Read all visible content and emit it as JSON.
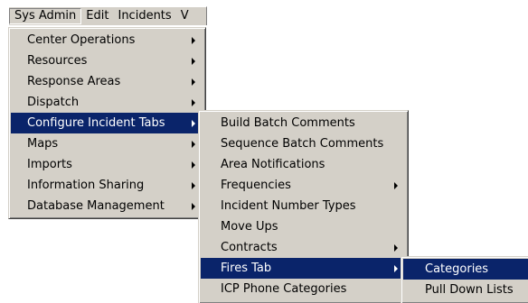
{
  "menubar": {
    "items": [
      "Sys Admin",
      "Edit",
      "Incidents",
      "V"
    ]
  },
  "sys_admin_menu": {
    "items": [
      "Center Operations",
      "Resources",
      "Response Areas",
      "Dispatch",
      "Configure Incident Tabs",
      "Maps",
      "Imports",
      "Information Sharing",
      "Database Management"
    ],
    "selected": "Configure Incident Tabs"
  },
  "configure_incident_tabs_menu": {
    "items": [
      "Build Batch Comments",
      "Sequence Batch Comments",
      "Area Notifications",
      "Frequencies",
      "Incident Number Types",
      "Move Ups",
      "Contracts",
      "Fires Tab",
      "ICP Phone Categories"
    ],
    "selected": "Fires Tab"
  },
  "fires_tab_menu": {
    "items": [
      "Categories",
      "Pull Down Lists"
    ],
    "selected": "Categories"
  },
  "colors": {
    "menu_background": "#d4d0c8",
    "selection_background": "#0a246a",
    "selection_text": "#ffffff"
  }
}
